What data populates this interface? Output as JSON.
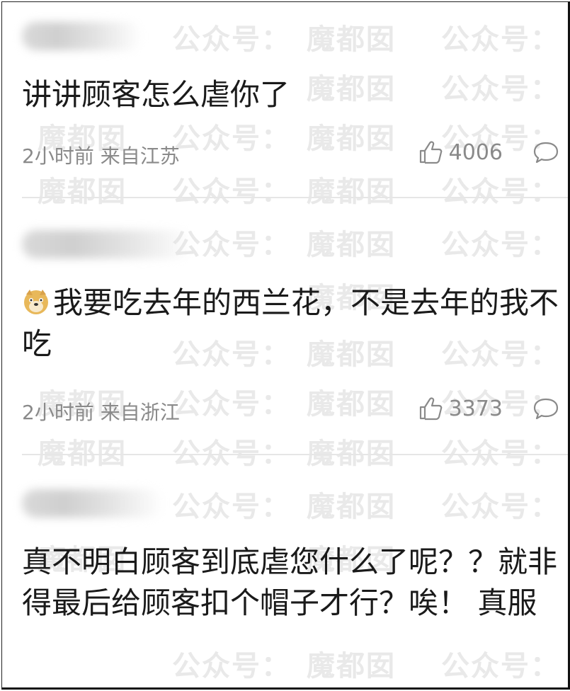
{
  "watermark_text": [
    "魔都囡",
    "公众号：",
    "魔都囡",
    "公众号："
  ],
  "comments": [
    {
      "text": "讲讲顾客怎么虐你了",
      "time": "2小时前",
      "location": "来自江苏",
      "likes": "4006"
    },
    {
      "emoji": "doge-emoji",
      "text": "我要吃去年的西兰花，不是去年的我不吃",
      "time": "2小时前",
      "location": "来自浙江",
      "likes": "3373"
    },
    {
      "text": "真不明白顾客到底虐您什么了呢？？就非得最后给顾客扣个帽子才行？唉！ 真服"
    }
  ],
  "icons": {
    "like": "thumbs-up-icon",
    "reply": "comment-bubble-icon"
  }
}
